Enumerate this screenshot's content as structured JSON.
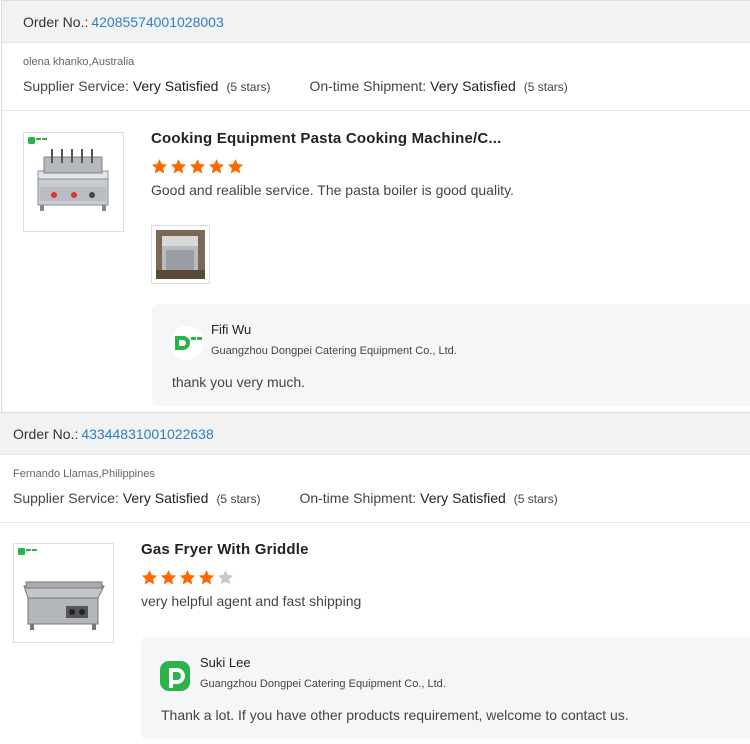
{
  "colors": {
    "star_on": "#ff6a00",
    "star_off": "#c8c8c8",
    "link": "#2f7fc1",
    "brand_green": "#2bb34a"
  },
  "reviews": [
    {
      "order_label": "Order No.:",
      "order_number": "42085574001028003",
      "buyer": "olena khanko,Australia",
      "supplier_label": "Supplier Service:",
      "supplier_value": "Very Satisfied",
      "supplier_stars": "(5 stars)",
      "shipment_label": "On-time Shipment:",
      "shipment_value": "Very Satisfied",
      "shipment_stars": "(5 stars)",
      "product_title": "Cooking Equipment Pasta Cooking Machine/C...",
      "rating": 5,
      "comment": "Good and realible service. The pasta boiler is good quality.",
      "product_image": "pasta-cooker-image",
      "has_photo": true,
      "reply_name": "Fifi Wu",
      "reply_company": "Guangzhou Dongpei Catering Equipment Co., Ltd.",
      "reply_text": "thank you very much."
    },
    {
      "order_label": "Order No.:",
      "order_number": "43344831001022638",
      "buyer": "Fernando Llamas,Philippines",
      "supplier_label": "Supplier Service:",
      "supplier_value": "Very Satisfied",
      "supplier_stars": "(5 stars)",
      "shipment_label": "On-time Shipment:",
      "shipment_value": "Very Satisfied",
      "shipment_stars": "(5 stars)",
      "product_title": "Gas Fryer With Griddle",
      "rating": 4,
      "comment": "very helpful agent and fast shipping",
      "product_image": "gas-griddle-image",
      "has_photo": false,
      "reply_name": "Suki Lee",
      "reply_company": "Guangzhou Dongpei Catering Equipment Co., Ltd.",
      "reply_text": "Thank a lot. If you have other products requirement, welcome to contact us."
    }
  ]
}
